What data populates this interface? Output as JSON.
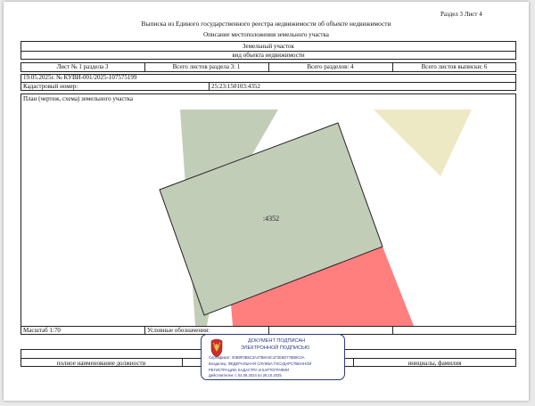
{
  "header": {
    "page_ref": "Раздел 3   Лист 4",
    "title": "Выписка из Единого государственного реестра недвижимости об объекте недвижимости",
    "subtitle": "Описание местоположения земельного участка"
  },
  "object": {
    "name": "Земельный участок",
    "kind": "вид объекта недвижимости"
  },
  "sheet_info": {
    "sheet_no": "Лист № 1 раздела 3",
    "total_sheets_section": "Всего листов раздела 3: 1",
    "total_sections": "Всего разделов: 4",
    "total_sheets_extract": "Всего листов выписки: 6"
  },
  "record": {
    "date_number": "19.05.2025г. № КУВИ-001/2025-107575199",
    "cadastral_label": "Кадастровый номер:",
    "cadastral_number": "25:23:150103:4352"
  },
  "plan": {
    "label": "План (чертеж, схема) земельного участка",
    "parcel_label": ":4352",
    "colors": {
      "parcel": "#c2cdb8",
      "neighbor": "#c2cdb8",
      "red_area": "#ff7f7f",
      "yellow_area": "#ede9c4"
    }
  },
  "scale": {
    "label": "Масштаб 1:70",
    "legend_label": "Условные обозначения:"
  },
  "footer": {
    "position_label": "полное наименование должности",
    "name_label": "инициалы, фамилия"
  },
  "stamp": {
    "title_line1": "ДОКУМЕНТ ПОДПИСАН",
    "title_line2": "ЭЛЕКТРОННОЙ ПОДПИСЬЮ",
    "certificate": "Сертификат: 00B9F0B5C3A47B8A9C1F2E6D775B8C0A",
    "owner_line1": "Владелец: ФЕДЕРАЛЬНАЯ СЛУЖБА ГОСУДАРСТВЕННОЙ",
    "owner_line2": "РЕГИСТРАЦИИ, КАДАСТРА И КАРТОГРАФИИ",
    "valid": "Действителен: с 02.08.2024 по 26.10.2025"
  }
}
